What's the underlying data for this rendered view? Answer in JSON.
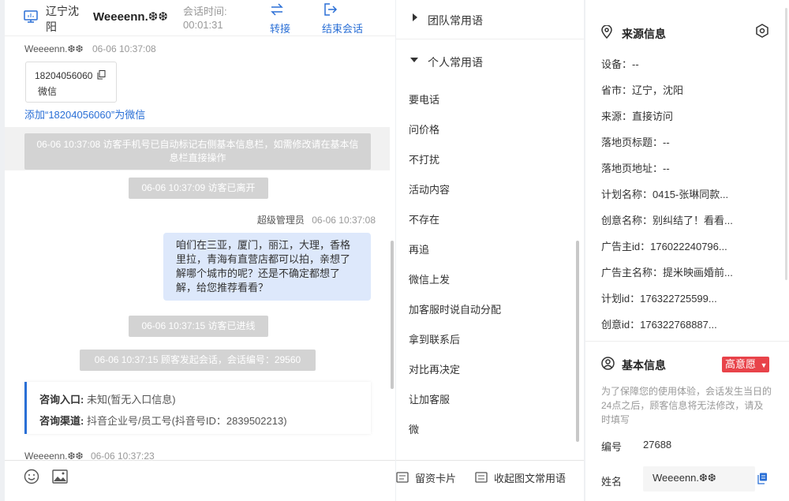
{
  "header": {
    "location_line1": "辽宁沈",
    "location_line2": "阳",
    "visitor_name": "Weeeenn.❆❆",
    "session_time_label": "会话时间:",
    "session_time_value": "00:01:31",
    "transfer_label": "转接",
    "end_session_label": "结束会话"
  },
  "chat": {
    "visitor_header_name": "Weeeenn.❆❆",
    "visitor_header_time": "06-06 10:37:08",
    "card_phone": "18204056060",
    "card_wechat": "微信",
    "add_wechat_link": "添加“18204056060”为微信",
    "sys_msg_1": "06-06 10:37:08 访客手机号已自动标记右侧基本信息栏，如需修改请在基本信息栏直接操作",
    "sys_msg_2": "06-06 10:37:09 访客已离开",
    "agent_name": "超级管理员",
    "agent_time": "06-06 10:37:08",
    "agent_message": "咱们在三亚，厦门，丽江，大理，香格里拉，青海有直营店都可以拍，亲想了解哪个城市的呢？还是不确定都想了解，给您推荐看看？",
    "sys_msg_3": "06-06 10:37:15 访客已进线",
    "sys_msg_4": "06-06 10:37:15 顾客发起会话，会话编号：29560",
    "inquiry_entry_label": "咨询入口:",
    "inquiry_entry_value": "未知(暂无入口信息)",
    "inquiry_channel_label": "咨询渠道:",
    "inquiry_channel_value": "抖音企业号/员工号(抖音号ID：2839502213)",
    "visitor_footer_name": "Weeeenn.❆❆",
    "visitor_footer_time": "06-06 10:37:23"
  },
  "toolbar": {
    "emoji_icon": "smile-icon",
    "image_icon": "image-icon",
    "leave_card_label": "留资卡片",
    "collapse_phrases_label": "收起图文常用语"
  },
  "phrases": {
    "team_group": "团队常用语",
    "personal_group": "个人常用语",
    "items": [
      "要电话",
      "问价格",
      "不打扰",
      "活动内容",
      "不存在",
      "再追",
      "微信上发",
      "加客服时说自动分配",
      "拿到联系后",
      "对比再决定",
      "让加客服",
      "微"
    ]
  },
  "source_info": {
    "title": "来源信息",
    "device": "设备：--",
    "province_city": "省市：辽宁，沈阳",
    "source": "来源：直接访问",
    "landing_title": "落地页标题：--",
    "landing_url": "落地页地址：--",
    "plan_name": "计划名称：0415-张琳同款...",
    "creative_name": "创意名称：别纠结了！看看...",
    "advertiser_id": "广告主id：176022240796...",
    "advertiser_name": "广告主名称：提米映画婚前...",
    "plan_id": "计划id：176322725599...",
    "creative_id": "创意id：176322768887..."
  },
  "basic_info": {
    "title": "基本信息",
    "intent_badge": "高意愿",
    "notice": "为了保障您的使用体验，会话发生当日的24点之后，顾客信息将无法修改，请及时填写",
    "number_label": "编号",
    "number_value": "27688",
    "name_label": "姓名",
    "name_value": "Weeeenn.❆❆"
  },
  "colors": {
    "accent_blue": "#2a6fd6",
    "bubble_bg": "#dde8fb",
    "badge_red": "#e8434a",
    "system_msg_bg": "#d3d3d3"
  }
}
